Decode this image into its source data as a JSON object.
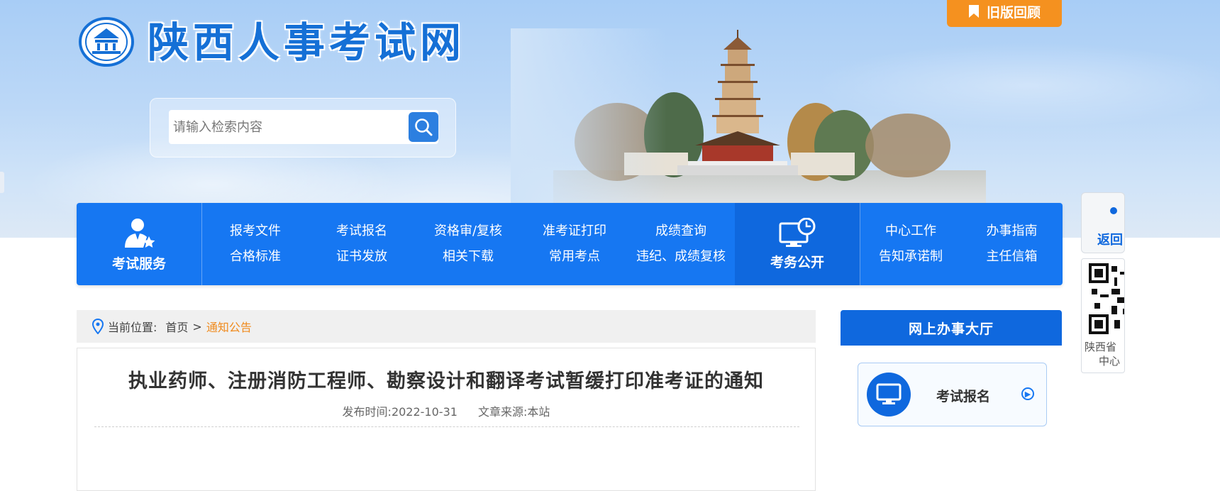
{
  "header": {
    "site_title": "陕西人事考试网",
    "old_version_label": "旧版回顾"
  },
  "search": {
    "placeholder": "请输入检索内容"
  },
  "nav": {
    "service_label": "考试服务",
    "affairs_label": "考务公开",
    "main_items": [
      "报考文件",
      "考试报名",
      "资格审/复核",
      "准考证打印",
      "成绩查询",
      "合格标准",
      "证书发放",
      "相关下载",
      "常用考点",
      "违纪、成绩复核"
    ],
    "side_items": [
      "中心工作",
      "办事指南",
      "告知承诺制",
      "主任信箱"
    ]
  },
  "right_float": {
    "back_label": "返回",
    "qr_caption_line1": "陕西省",
    "qr_caption_line2": "中心"
  },
  "breadcrumb": {
    "prefix": "当前位置:",
    "home": "首页",
    "separator": ">",
    "current": "通知公告"
  },
  "article": {
    "title": "执业药师、注册消防工程师、勘察设计和翻译考试暂缓打印准考证的通知",
    "publish_label": "发布时间:2022-10-31",
    "source_label": "文章来源:本站"
  },
  "hall": {
    "title": "网上办事大厅",
    "card_label": "考试报名"
  },
  "colors": {
    "nav_blue": "#1677f2",
    "dark_blue": "#0f68de",
    "orange": "#f5911f",
    "crumb_orange": "#f08a1c"
  }
}
